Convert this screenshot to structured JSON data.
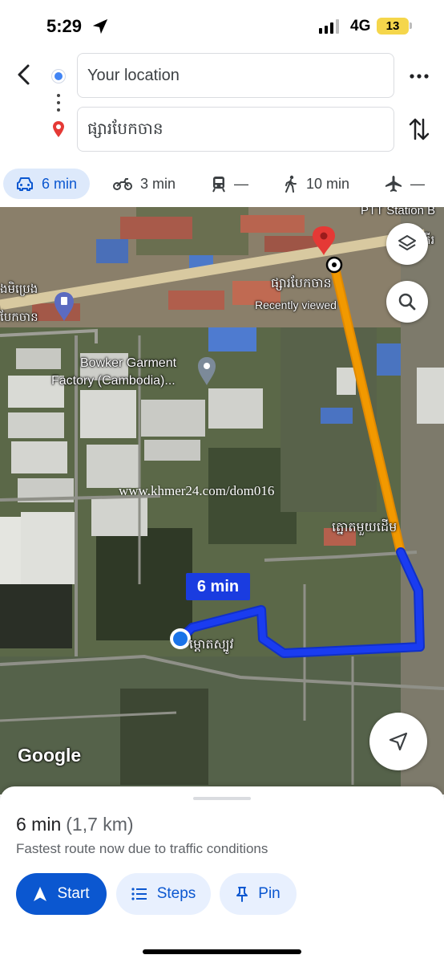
{
  "status": {
    "time": "5:29",
    "network": "4G",
    "battery": "13"
  },
  "header": {
    "origin_value": "Your location",
    "destination_value": "ផ្សារបែកចាន"
  },
  "modes": [
    {
      "icon": "car-icon",
      "label": "6 min"
    },
    {
      "icon": "motorcycle-icon",
      "label": "3 min"
    },
    {
      "icon": "transit-icon",
      "label": "—"
    },
    {
      "icon": "walk-icon",
      "label": "10 min"
    },
    {
      "icon": "flight-icon",
      "label": "—"
    }
  ],
  "map": {
    "labels": {
      "station": "PTT Station B",
      "gas_station": "ងមិប្រេង",
      "gas_station_2": "បែកចាន",
      "market": "ផ្សារបែកចាន",
      "recently_viewed": "Recently viewed",
      "factory_1": "Bowker Garment",
      "factory_2": "Factory (Cambodia)...",
      "watermark": "www.khmer24.com/dom016",
      "road_1": "ត្នោតមួយដើម",
      "road_2": "ម្តោតស្បូវ",
      "right_edge": "គីរ"
    },
    "route_time": "6 min",
    "google": "Google",
    "route_colors": {
      "traffic": "#f29900",
      "clear": "#1a3cf0"
    }
  },
  "sheet": {
    "duration": "6 min",
    "distance": "(1,7 km)",
    "note": "Fastest route now due to traffic conditions",
    "start_label": "Start",
    "steps_label": "Steps",
    "pin_label": "Pin"
  }
}
